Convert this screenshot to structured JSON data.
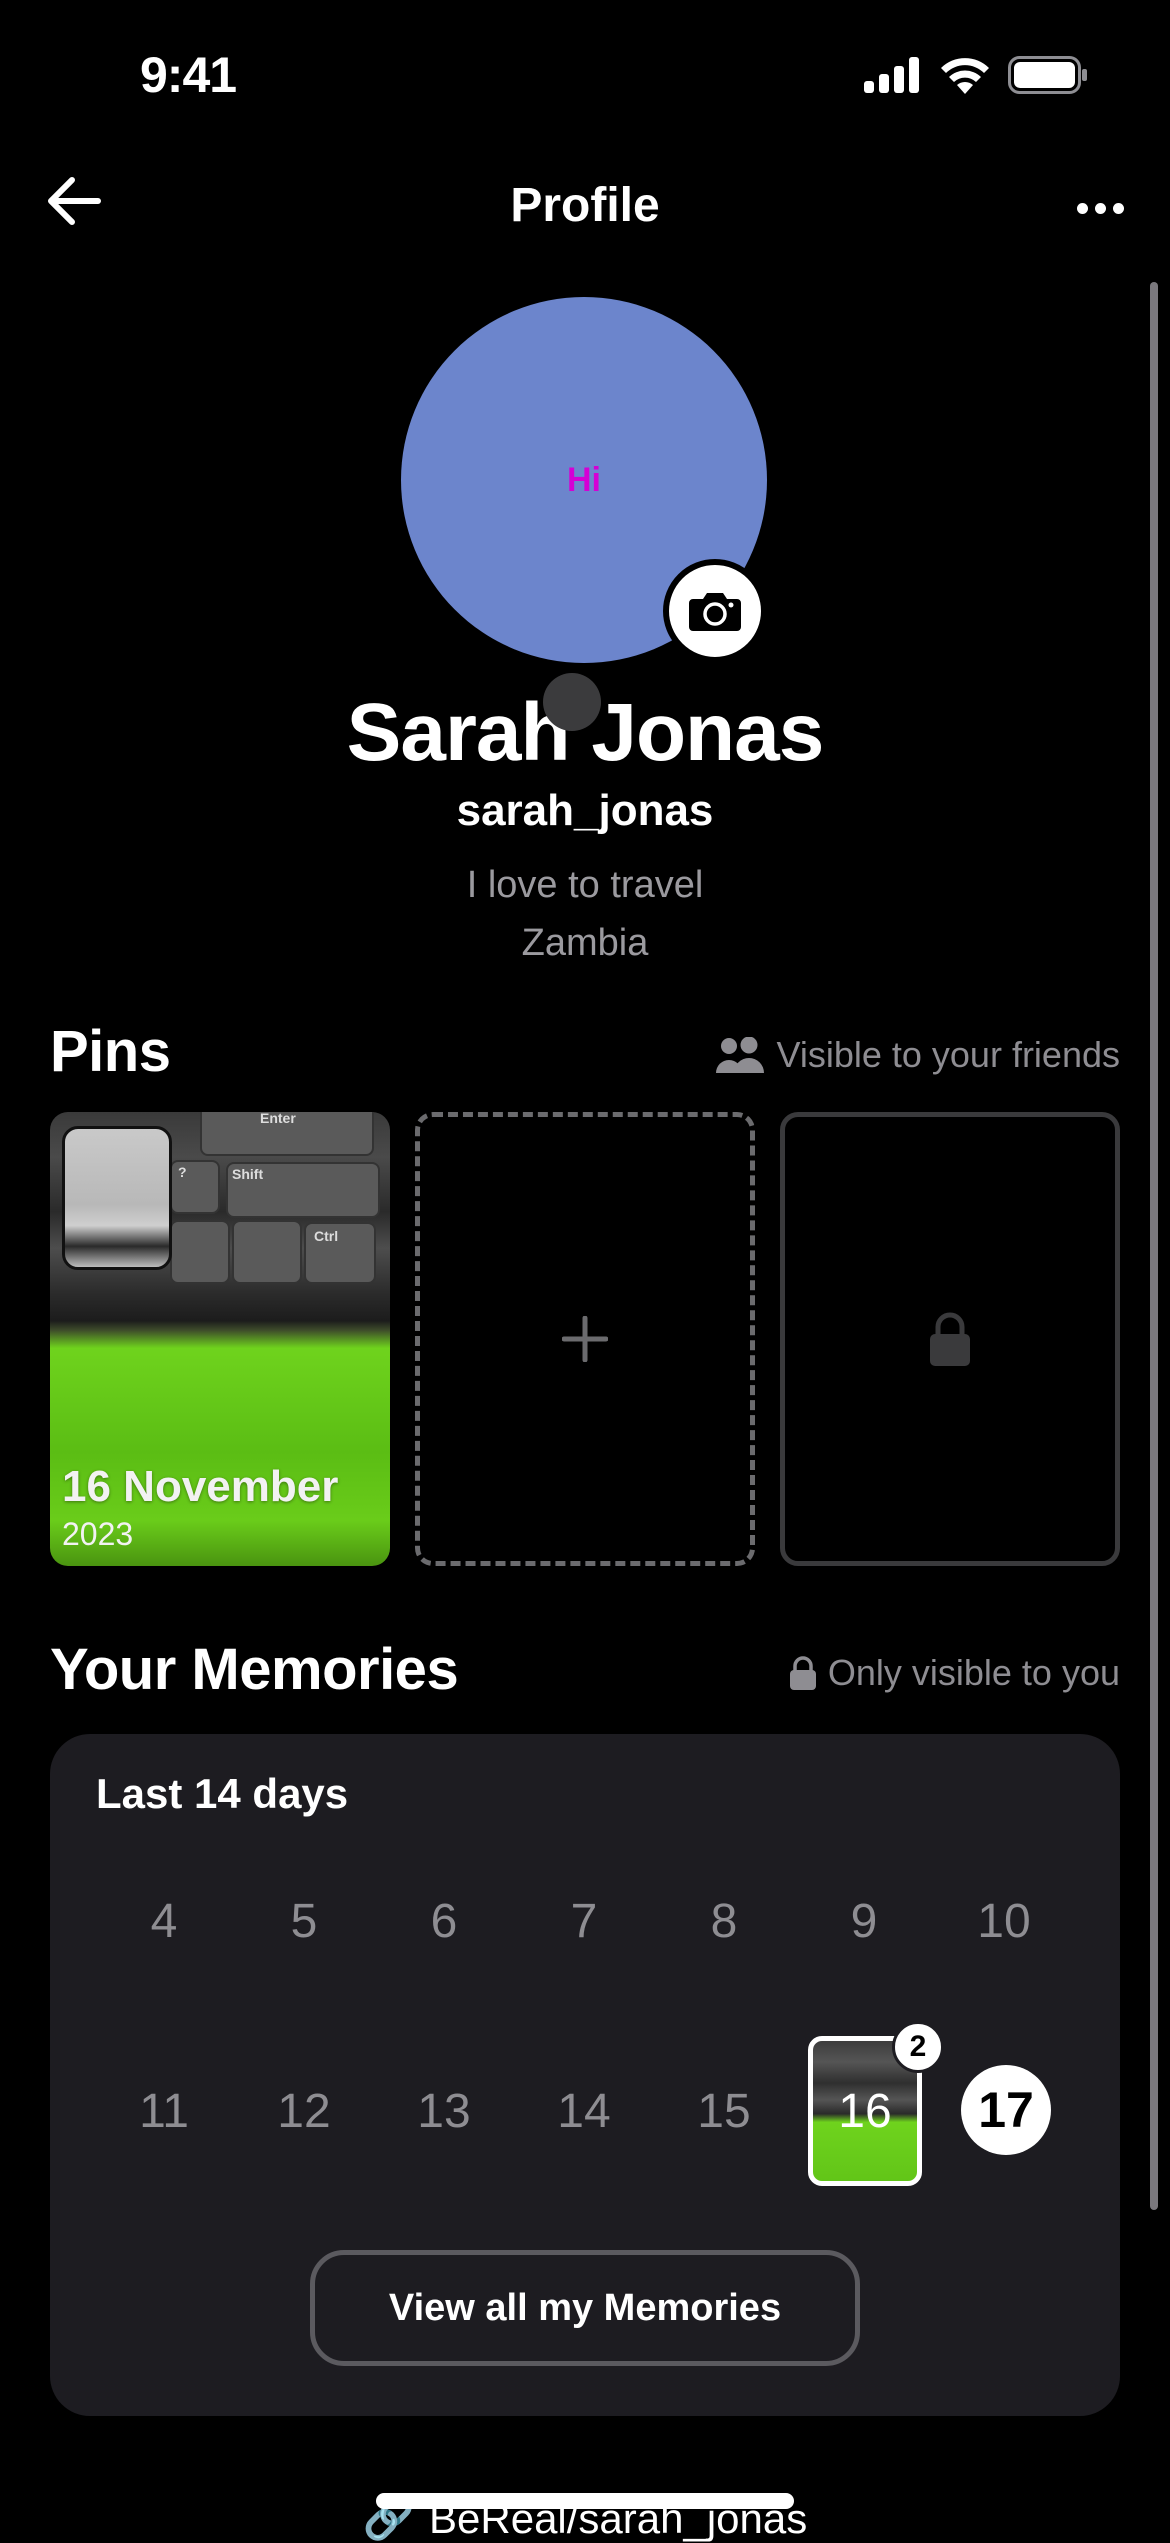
{
  "status_bar": {
    "time": "9:41",
    "icons": [
      "cellular-signal-icon",
      "wifi-icon",
      "battery-icon"
    ]
  },
  "nav": {
    "back_icon": "arrow-left-icon",
    "title": "Profile",
    "more_icon": "ellipsis-icon"
  },
  "profile": {
    "avatar_text": "Hi",
    "avatar_color": "#6c85cc",
    "avatar_text_color": "#d500d5",
    "camera_icon": "camera-icon",
    "name": "Sarah Jonas",
    "username": "sarah_jonas",
    "bio": "I love to travel",
    "location": "Zambia"
  },
  "pins": {
    "title": "Pins",
    "visibility_icon": "friends-icon",
    "visibility_label": "Visible to your friends",
    "items": [
      {
        "type": "photo",
        "date": "16 November",
        "year": "2023",
        "key_labels": [
          "Enter",
          "?",
          "/",
          "Shift",
          "Ctrl"
        ]
      },
      {
        "type": "add",
        "icon": "plus-icon"
      },
      {
        "type": "locked",
        "icon": "lock-icon"
      }
    ]
  },
  "memories": {
    "title": "Your Memories",
    "visibility_icon": "lock-icon",
    "visibility_label": "Only visible to you",
    "card_title": "Last 14 days",
    "week1": [
      "4",
      "5",
      "6",
      "7",
      "8",
      "9",
      "10"
    ],
    "week2": [
      "11",
      "12",
      "13",
      "14",
      "15"
    ],
    "photo_day": {
      "day": "16",
      "count": "2"
    },
    "today": "17",
    "view_all_label": "View all my Memories"
  },
  "footer": {
    "link_icon": "link-icon",
    "link_text": "BeReal/sarah_jonas"
  }
}
